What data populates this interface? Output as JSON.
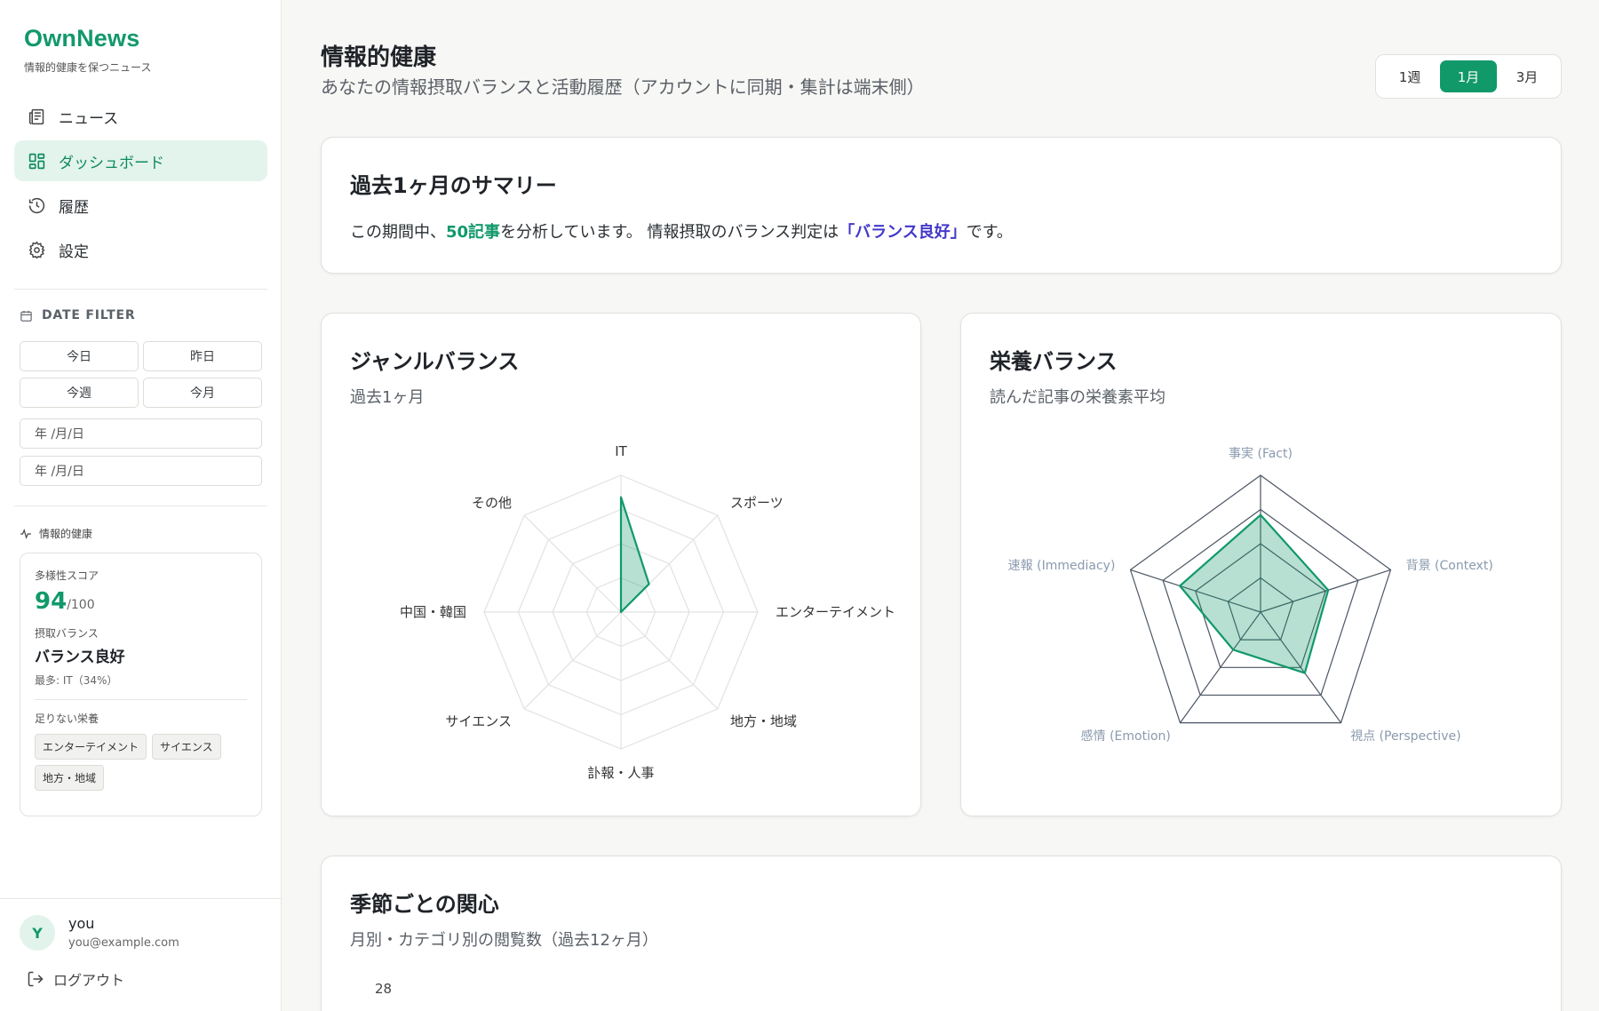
{
  "brand": {
    "name": "OwnNews",
    "tagline": "情報的健康を保つニュース"
  },
  "nav": [
    {
      "label": "ニュース",
      "icon": "newspaper-icon",
      "active": false
    },
    {
      "label": "ダッシュボード",
      "icon": "dashboard-icon",
      "active": true
    },
    {
      "label": "履歴",
      "icon": "history-icon",
      "active": false
    },
    {
      "label": "設定",
      "icon": "gear-icon",
      "active": false
    }
  ],
  "date_filter": {
    "title": "DATE FILTER",
    "buttons": [
      "今日",
      "昨日",
      "今週",
      "今月"
    ],
    "start_placeholder": "年 /月/日",
    "end_placeholder": "年 /月/日"
  },
  "info_health": {
    "title": "情報的健康",
    "diversity_label": "多様性スコア",
    "score": "94",
    "score_max": "/100",
    "balance_label": "摂取バランス",
    "balance_value": "バランス良好",
    "most": "最多: IT（34%）",
    "lacking_label": "足りない栄養",
    "lacking": [
      "エンターテイメント",
      "サイエンス",
      "地方・地域"
    ]
  },
  "user": {
    "initial": "Y",
    "name": "you",
    "email": "you@example.com",
    "logout": "ログアウト"
  },
  "header": {
    "title": "情報的健康",
    "subtitle": "あなたの情報摂取バランスと活動履歴（アカウントに同期・集計は端末側）",
    "ranges": [
      "1週",
      "1月",
      "3月"
    ],
    "active_range": "1月"
  },
  "summary": {
    "title": "過去1ヶ月のサマリー",
    "text_pre": "この期間中、",
    "count": "50記事",
    "text_mid": "を分析しています。 情報摂取のバランス判定は",
    "verdict": "「バランス良好」",
    "text_post": "です。"
  },
  "genre_card": {
    "title": "ジャンルバランス",
    "subtitle": "過去1ヶ月"
  },
  "nutrition_card": {
    "title": "栄養バランス",
    "subtitle": "読んだ記事の栄養素平均"
  },
  "season_card": {
    "title": "季節ごとの関心",
    "subtitle": "月別・カテゴリ別の閲覧数（過去12ヶ月）",
    "first_tick": "28"
  },
  "colors": {
    "accent": "#12996a",
    "verdict": "#4338ca"
  },
  "chart_data": [
    {
      "type": "radar",
      "axes": [
        "IT",
        "スポーツ",
        "エンターテイメント",
        "地方・地域",
        "訃報・人事",
        "サイエンス",
        "中国・韓国",
        "その他"
      ],
      "values": [
        0.84,
        0.29,
        0,
        0,
        0,
        0,
        0,
        0
      ],
      "max": 1,
      "grid": true
    },
    {
      "type": "radar",
      "axes": [
        "事実 (Fact)",
        "背景 (Context)",
        "視点 (Perspective)",
        "感情 (Emotion)",
        "速報 (Immediacy)"
      ],
      "values": [
        0.71,
        0.52,
        0.55,
        0.34,
        0.62
      ],
      "max": 1,
      "grid": true
    }
  ]
}
